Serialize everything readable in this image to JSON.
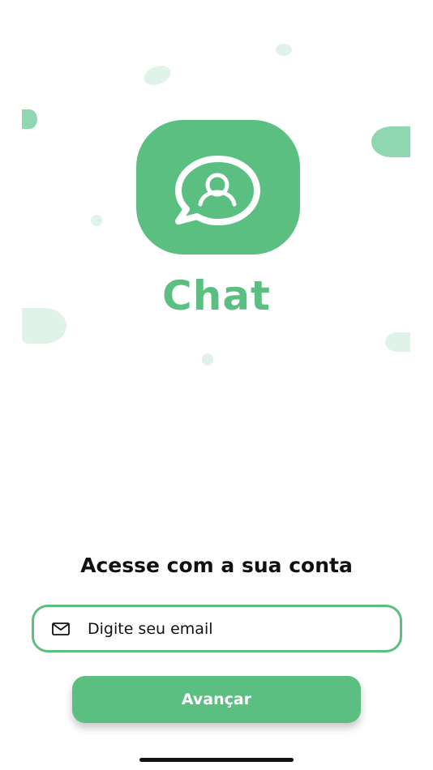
{
  "app": {
    "brand_name": "Chat",
    "logo_icon": "chat-bubble-user-icon"
  },
  "login": {
    "heading": "Acesse com a sua conta",
    "email_field": {
      "placeholder": "Digite seu email",
      "value": "",
      "icon": "mail-icon"
    },
    "submit_label": "Avançar"
  },
  "colors": {
    "brand_green": "#5cbf82",
    "blob_light": "#dff3e8",
    "blob_dark": "#8fd7b1",
    "text_dark": "#111111",
    "background": "#ffffff"
  }
}
